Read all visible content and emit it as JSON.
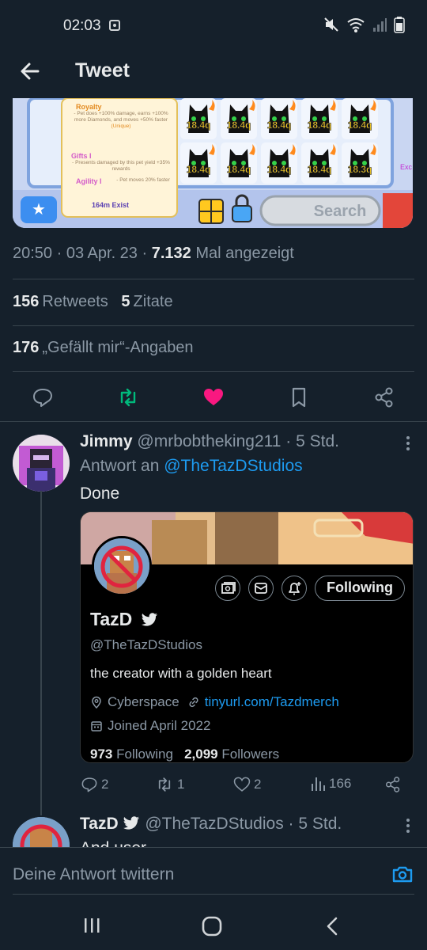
{
  "status": {
    "time": "02:03"
  },
  "topbar": {
    "title": "Tweet"
  },
  "tweet": {
    "time": "20:50",
    "date": "03 Apr. 23",
    "views": "7.132",
    "views_label": "Mal angezeigt",
    "retweets": "156",
    "retweets_label": "Retweets",
    "quotes": "5",
    "quotes_label": "Zitate",
    "likes": "176",
    "likes_label": "„Gefällt mir“-Angaben",
    "liked": true,
    "retweeted": true,
    "media": {
      "royalty_title": "Royalty",
      "royalty_text": "- Pet does +100% damage, earns +100% more Diamonds, and moves +50% faster",
      "unique": "(Unique)",
      "gifts_title": "Gifts I",
      "gifts_text": "- Presents damaged by this pet yield +35% rewards",
      "agility_title": "Agility I",
      "agility_text": "- Pet moves 20% faster",
      "exist": "164m Exist",
      "pet_values": [
        "18.4q",
        "18.4q",
        "18.4q",
        "18.4q",
        "18.4q",
        "18.4q",
        "18.4q",
        "18.4q",
        "18.4q",
        "18.3q"
      ],
      "search": "Search",
      "edge": "Exc"
    }
  },
  "reply": {
    "name": "Jimmy",
    "handle": "@mrbobtheking211",
    "time": "5 Std.",
    "reply_to_prefix": "Antwort an",
    "reply_to": "@TheTazDStudios",
    "text": "Done",
    "card": {
      "name": "TazD",
      "handle": "@TheTazDStudios",
      "bio": "the creator with a golden heart",
      "location": "Cyberspace",
      "link": "tinyurl.com/Tazdmerch",
      "joined": "Joined April 2022",
      "following_count": "973",
      "following_label": "Following",
      "followers_count": "2,099",
      "followers_label": "Followers",
      "follow_button": "Following"
    },
    "replies": "2",
    "retweets": "1",
    "likes": "2",
    "views": "166"
  },
  "next_reply": {
    "name": "TazD",
    "handle": "@TheTazDStudios",
    "time": "5 Std.",
    "text": "And user"
  },
  "compose": {
    "placeholder": "Deine Antwort twittern"
  },
  "colors": {
    "background": "#15202b",
    "accent": "#1d9bf0",
    "like": "#f91880",
    "retweet": "#00ba7c",
    "muted": "#8b98a5"
  }
}
